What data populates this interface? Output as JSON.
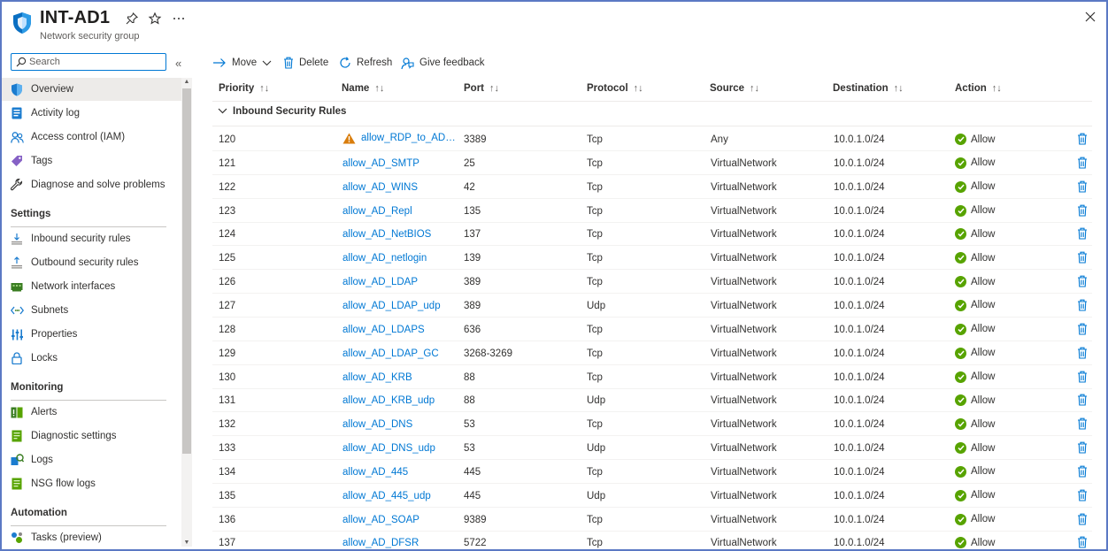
{
  "header": {
    "title": "INT-AD1",
    "subtitle": "Network security group"
  },
  "sidebar": {
    "search_placeholder": "Search",
    "collapse_glyph": "«",
    "items": [
      {
        "label": "Overview",
        "icon": "shield-icon",
        "active": true
      },
      {
        "label": "Activity log",
        "icon": "activity-log-icon"
      },
      {
        "label": "Access control (IAM)",
        "icon": "people-icon"
      },
      {
        "label": "Tags",
        "icon": "tag-icon"
      },
      {
        "label": "Diagnose and solve problems",
        "icon": "wrench-icon"
      }
    ],
    "settings_title": "Settings",
    "settings_items": [
      {
        "label": "Inbound security rules",
        "icon": "inbound-icon"
      },
      {
        "label": "Outbound security rules",
        "icon": "outbound-icon"
      },
      {
        "label": "Network interfaces",
        "icon": "network-interface-icon"
      },
      {
        "label": "Subnets",
        "icon": "subnet-icon"
      },
      {
        "label": "Properties",
        "icon": "properties-icon"
      },
      {
        "label": "Locks",
        "icon": "lock-icon"
      }
    ],
    "monitoring_title": "Monitoring",
    "monitoring_items": [
      {
        "label": "Alerts",
        "icon": "alerts-icon"
      },
      {
        "label": "Diagnostic settings",
        "icon": "diagnostic-icon"
      },
      {
        "label": "Logs",
        "icon": "logs-icon"
      },
      {
        "label": "NSG flow logs",
        "icon": "flow-logs-icon"
      }
    ],
    "automation_title": "Automation",
    "automation_items": [
      {
        "label": "Tasks (preview)",
        "icon": "tasks-icon"
      }
    ]
  },
  "toolbar": {
    "move": "Move",
    "delete": "Delete",
    "refresh": "Refresh",
    "feedback": "Give feedback"
  },
  "table": {
    "columns": [
      "Priority",
      "Name",
      "Port",
      "Protocol",
      "Source",
      "Destination",
      "Action"
    ],
    "sort_glyph": "↑↓",
    "group_label": "Inbound Security Rules",
    "rows": [
      {
        "priority": "120",
        "name": "allow_RDP_to_AD_Se...",
        "warning": true,
        "port": "3389",
        "protocol": "Tcp",
        "source": "Any",
        "destination": "10.0.1.0/24",
        "action": "Allow"
      },
      {
        "priority": "121",
        "name": "allow_AD_SMTP",
        "port": "25",
        "protocol": "Tcp",
        "source": "VirtualNetwork",
        "destination": "10.0.1.0/24",
        "action": "Allow"
      },
      {
        "priority": "122",
        "name": "allow_AD_WINS",
        "port": "42",
        "protocol": "Tcp",
        "source": "VirtualNetwork",
        "destination": "10.0.1.0/24",
        "action": "Allow"
      },
      {
        "priority": "123",
        "name": "allow_AD_Repl",
        "port": "135",
        "protocol": "Tcp",
        "source": "VirtualNetwork",
        "destination": "10.0.1.0/24",
        "action": "Allow"
      },
      {
        "priority": "124",
        "name": "allow_AD_NetBIOS",
        "port": "137",
        "protocol": "Tcp",
        "source": "VirtualNetwork",
        "destination": "10.0.1.0/24",
        "action": "Allow"
      },
      {
        "priority": "125",
        "name": "allow_AD_netlogin",
        "port": "139",
        "protocol": "Tcp",
        "source": "VirtualNetwork",
        "destination": "10.0.1.0/24",
        "action": "Allow"
      },
      {
        "priority": "126",
        "name": "allow_AD_LDAP",
        "port": "389",
        "protocol": "Tcp",
        "source": "VirtualNetwork",
        "destination": "10.0.1.0/24",
        "action": "Allow"
      },
      {
        "priority": "127",
        "name": "allow_AD_LDAP_udp",
        "port": "389",
        "protocol": "Udp",
        "source": "VirtualNetwork",
        "destination": "10.0.1.0/24",
        "action": "Allow"
      },
      {
        "priority": "128",
        "name": "allow_AD_LDAPS",
        "port": "636",
        "protocol": "Tcp",
        "source": "VirtualNetwork",
        "destination": "10.0.1.0/24",
        "action": "Allow"
      },
      {
        "priority": "129",
        "name": "allow_AD_LDAP_GC",
        "port": "3268-3269",
        "protocol": "Tcp",
        "source": "VirtualNetwork",
        "destination": "10.0.1.0/24",
        "action": "Allow"
      },
      {
        "priority": "130",
        "name": "allow_AD_KRB",
        "port": "88",
        "protocol": "Tcp",
        "source": "VirtualNetwork",
        "destination": "10.0.1.0/24",
        "action": "Allow"
      },
      {
        "priority": "131",
        "name": "allow_AD_KRB_udp",
        "port": "88",
        "protocol": "Udp",
        "source": "VirtualNetwork",
        "destination": "10.0.1.0/24",
        "action": "Allow"
      },
      {
        "priority": "132",
        "name": "allow_AD_DNS",
        "port": "53",
        "protocol": "Tcp",
        "source": "VirtualNetwork",
        "destination": "10.0.1.0/24",
        "action": "Allow"
      },
      {
        "priority": "133",
        "name": "allow_AD_DNS_udp",
        "port": "53",
        "protocol": "Udp",
        "source": "VirtualNetwork",
        "destination": "10.0.1.0/24",
        "action": "Allow"
      },
      {
        "priority": "134",
        "name": "allow_AD_445",
        "port": "445",
        "protocol": "Tcp",
        "source": "VirtualNetwork",
        "destination": "10.0.1.0/24",
        "action": "Allow"
      },
      {
        "priority": "135",
        "name": "allow_AD_445_udp",
        "port": "445",
        "protocol": "Udp",
        "source": "VirtualNetwork",
        "destination": "10.0.1.0/24",
        "action": "Allow"
      },
      {
        "priority": "136",
        "name": "allow_AD_SOAP",
        "port": "9389",
        "protocol": "Tcp",
        "source": "VirtualNetwork",
        "destination": "10.0.1.0/24",
        "action": "Allow"
      },
      {
        "priority": "137",
        "name": "allow_AD_DFSR",
        "port": "5722",
        "protocol": "Tcp",
        "source": "VirtualNetwork",
        "destination": "10.0.1.0/24",
        "action": "Allow"
      }
    ]
  },
  "colors": {
    "accent": "#0078d4",
    "allow_green": "#57a300",
    "warning_orange": "#d97d0c",
    "frame_border": "#5b79c4"
  }
}
